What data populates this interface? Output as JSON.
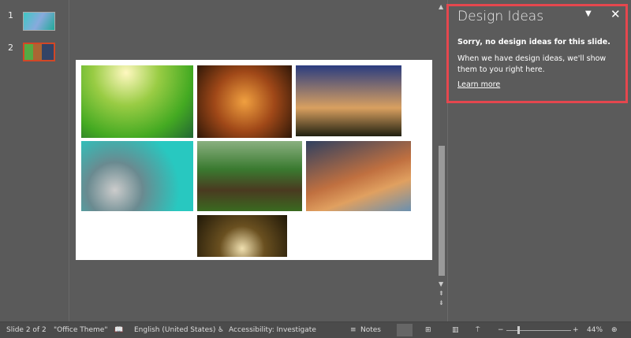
{
  "thumbnails": [
    {
      "number": "1"
    },
    {
      "number": "2"
    }
  ],
  "design_ideas": {
    "title": "Design Ideas",
    "heading": "Sorry, no design ideas for this slide.",
    "message": "When we have design ideas, we'll show them to you right here.",
    "link": "Learn more"
  },
  "status": {
    "slide": "Slide 2 of 2",
    "theme": "\"Office Theme\"",
    "language": "English (United States)",
    "accessibility": "Accessibility: Investigate",
    "notes": "Notes",
    "zoom": "44%"
  },
  "colors": {
    "highlight": "#e5474e",
    "selected_thumb": "#d24726"
  }
}
